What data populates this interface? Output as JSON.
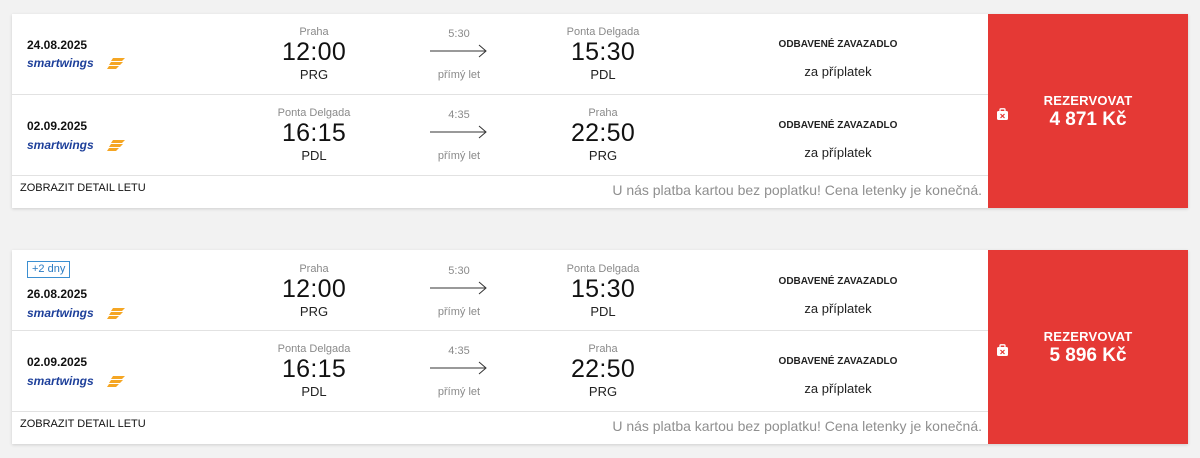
{
  "colors": {
    "accent_red": "#e53935",
    "badge_blue": "#2a7bc2",
    "airline_blue": "#1d3f9a",
    "airline_orange": "#f5a623"
  },
  "results": [
    {
      "badge": "",
      "legs": [
        {
          "date": "24.08.2025",
          "airline": "smartwings",
          "dep_city": "Praha",
          "dep_time": "12:00",
          "dep_code": "PRG",
          "duration": "5:30",
          "direct": "přímý let",
          "arr_city": "Ponta Delgada",
          "arr_time": "15:30",
          "arr_code": "PDL",
          "baggage_title": "ODBAVENÉ ZAVAZADLO",
          "baggage_sub": "za příplatek"
        },
        {
          "date": "02.09.2025",
          "airline": "smartwings",
          "dep_city": "Ponta Delgada",
          "dep_time": "16:15",
          "dep_code": "PDL",
          "duration": "4:35",
          "direct": "přímý let",
          "arr_city": "Praha",
          "arr_time": "22:50",
          "arr_code": "PRG",
          "baggage_title": "ODBAVENÉ ZAVAZADLO",
          "baggage_sub": "za příplatek"
        }
      ],
      "detail_link": "ZOBRAZIT DETAIL LETU",
      "payment_note": "U nás platba kartou bez poplatku! Cena letenky je konečná.",
      "book_label": "REZERVOVAT",
      "price": "4 871 Kč",
      "book_icon": "baggage-icon"
    },
    {
      "badge": "+2 dny",
      "legs": [
        {
          "date": "26.08.2025",
          "airline": "smartwings",
          "dep_city": "Praha",
          "dep_time": "12:00",
          "dep_code": "PRG",
          "duration": "5:30",
          "direct": "přímý let",
          "arr_city": "Ponta Delgada",
          "arr_time": "15:30",
          "arr_code": "PDL",
          "baggage_title": "ODBAVENÉ ZAVAZADLO",
          "baggage_sub": "za příplatek"
        },
        {
          "date": "02.09.2025",
          "airline": "smartwings",
          "dep_city": "Ponta Delgada",
          "dep_time": "16:15",
          "dep_code": "PDL",
          "duration": "4:35",
          "direct": "přímý let",
          "arr_city": "Praha",
          "arr_time": "22:50",
          "arr_code": "PRG",
          "baggage_title": "ODBAVENÉ ZAVAZADLO",
          "baggage_sub": "za příplatek"
        }
      ],
      "detail_link": "ZOBRAZIT DETAIL LETU",
      "payment_note": "U nás platba kartou bez poplatku! Cena letenky je konečná.",
      "book_label": "REZERVOVAT",
      "price": "5 896 Kč",
      "book_icon": "baggage-icon"
    }
  ]
}
